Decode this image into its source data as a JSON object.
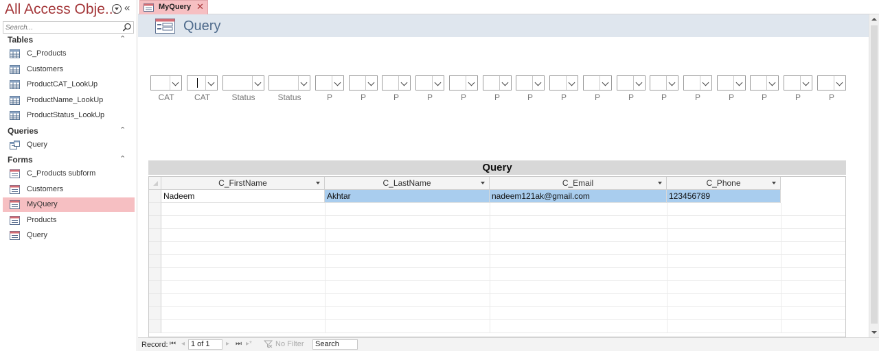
{
  "nav": {
    "title": "All Access Obje...",
    "collapse_glyph": "«",
    "search_placeholder": "Search...",
    "groups": [
      {
        "label": "Tables",
        "toggle_glyph": "⌃",
        "items": [
          {
            "label": "C_Products",
            "icon": "table-icon"
          },
          {
            "label": "Customers",
            "icon": "table-icon"
          },
          {
            "label": "ProductCAT_LookUp",
            "icon": "table-icon"
          },
          {
            "label": "ProductName_LookUp",
            "icon": "table-icon"
          },
          {
            "label": "ProductStatus_LookUp",
            "icon": "table-icon"
          }
        ]
      },
      {
        "label": "Queries",
        "toggle_glyph": "⌃",
        "items": [
          {
            "label": "Query",
            "icon": "query-icon"
          }
        ]
      },
      {
        "label": "Forms",
        "toggle_glyph": "⌃",
        "items": [
          {
            "label": "C_Products subform",
            "icon": "form-icon"
          },
          {
            "label": "Customers",
            "icon": "form-icon"
          },
          {
            "label": "MyQuery",
            "icon": "form-icon",
            "selected": true
          },
          {
            "label": "Products",
            "icon": "form-icon"
          },
          {
            "label": "Query",
            "icon": "form-icon"
          }
        ]
      }
    ]
  },
  "tab": {
    "label": "MyQuery",
    "close_glyph": "✕"
  },
  "form": {
    "title": "Query",
    "filters": [
      {
        "label": "CAT"
      },
      {
        "label": "CAT",
        "focused": true
      },
      {
        "label": "Status"
      },
      {
        "label": "Status"
      },
      {
        "label": "P"
      },
      {
        "label": "P"
      },
      {
        "label": "P"
      },
      {
        "label": "P"
      },
      {
        "label": "P"
      },
      {
        "label": "P"
      },
      {
        "label": "P"
      },
      {
        "label": "P"
      },
      {
        "label": "P"
      },
      {
        "label": "P"
      },
      {
        "label": "P"
      },
      {
        "label": "P"
      },
      {
        "label": "P"
      },
      {
        "label": "P"
      },
      {
        "label": "P"
      },
      {
        "label": "P"
      }
    ],
    "subform": {
      "title": "Query",
      "columns": [
        "C_FirstName",
        "C_LastName",
        "C_Email",
        "C_Phone"
      ],
      "rows": [
        [
          "Nadeem",
          "Akhtar",
          "nadeem121ak@gmail.com",
          "123456789"
        ]
      ]
    }
  },
  "record_bar": {
    "label": "Record:",
    "first_glyph": "⏮",
    "prev_glyph": "◂",
    "current": "1 of 1",
    "next_glyph": "▸",
    "last_glyph": "⏭",
    "new_glyph": "▸*",
    "filter_label": "No Filter",
    "search_label": "Search"
  },
  "colors": {
    "accent": "#a4373a",
    "selected": "#f6bfc2",
    "header_band": "#dfe6ee",
    "cell_highlight": "#a9cdee"
  }
}
